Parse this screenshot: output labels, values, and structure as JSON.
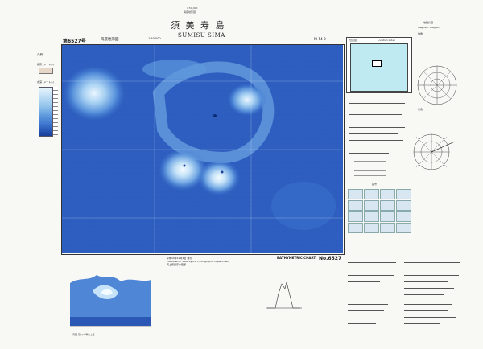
{
  "header": {
    "small_top": "1:50,000",
    "small_sub": "海底地形図",
    "title_jp": "須 美 寿 島",
    "title_romaji": "SUMISU  SIMA",
    "sheet_number": "第6527号",
    "map_type": "海底地形図",
    "scale_text": "1:50,000",
    "code_right": "NI-54-8"
  },
  "legend": {
    "top_label": "凡例",
    "depth_title": "水深 (メートル)",
    "elevation_title": "標高 (メートル)"
  },
  "index_map": {
    "title": "位置図",
    "sub": "Location Index"
  },
  "right_panel": {
    "title": "地磁気図",
    "sub": "Magnetic Diagram",
    "label_1": "偏角",
    "label_2": "伏角"
  },
  "symbols": {
    "title": "記号",
    "sub": "Symbols"
  },
  "imprint": {
    "line1": "平成10年12月1日 発行",
    "line2": "Published in 1998 by the Hydrographic Department",
    "line3": "海上保安庁水路部"
  },
  "bottom": {
    "survey_label": "BATHYMETRIC CHART",
    "sheet_no": "No.6527",
    "note": "海図 第1(2)号による"
  },
  "colors": {
    "deep": "#1f47a8",
    "mid": "#3f78d0",
    "shallow": "#8fc1ea",
    "shoal": "#dbeefc",
    "index_sea": "#bfeaf2"
  }
}
